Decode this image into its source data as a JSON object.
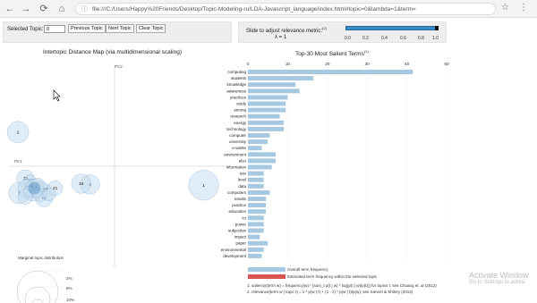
{
  "browser": {
    "url": "file:///C:/Users/Happy%20Friends/Desktop/Topic-Modeling-ru/LDA-Javascript_language/index.html#topic=0&lambda=1&term=",
    "back_icon": "←",
    "forward_icon": "→",
    "refresh_icon": "⟳",
    "home_icon": "⌂",
    "info_icon": "ⓘ",
    "star_icon": "☆",
    "menu_icon": "⋮"
  },
  "controls": {
    "selected_topic_label": "Selected Topic:",
    "topic_value": "0",
    "prev_label": "Previous Topic",
    "next_label": "Next Topic",
    "clear_label": "Clear Topic"
  },
  "relevance": {
    "title": "Slide to adjust relevance metric:",
    "footnote": "(2)",
    "lambda_text": "λ = 1",
    "ticks": [
      "0.0",
      "0.2",
      "0.4",
      "0.6",
      "0.8",
      "1.0"
    ],
    "lambda_value": 1
  },
  "map": {
    "title": "Intertopic Distance Map (via multidimensional scaling)",
    "pc1": "PC1",
    "pc2": "PC2",
    "marginal_title": "Marginal topic distribution",
    "legend": [
      "2%",
      "5%",
      "10%"
    ],
    "topics": [
      {
        "label": "1",
        "x": 1.2,
        "y": -0.25,
        "r": 1.4
      },
      {
        "label": "2",
        "x": -1.3,
        "y": 0.45,
        "r": 1.0
      },
      {
        "label": "3",
        "x": -1.28,
        "y": -0.35,
        "r": 1.0
      },
      {
        "label": "6",
        "x": -0.33,
        "y": -0.24,
        "r": 0.9
      },
      {
        "label": "12",
        "x": -0.95,
        "y": -0.42,
        "r": 0.8
      },
      {
        "label": "19",
        "x": -1.2,
        "y": -0.16,
        "r": 0.8
      },
      {
        "label": "21",
        "x": -0.8,
        "y": -0.29,
        "r": 0.7
      },
      {
        "label": "23",
        "x": -1.14,
        "y": -0.2,
        "r": 0.6
      },
      {
        "label": "34",
        "x": -0.45,
        "y": -0.23,
        "r": 0.9
      },
      {
        "label": "37",
        "x": -1.01,
        "y": -0.32,
        "r": 0.5
      },
      {
        "label": "40",
        "x": -0.93,
        "y": -0.3,
        "r": 0.5
      },
      {
        "label": "18",
        "x": -1.12,
        "y": -0.25,
        "r": 0.6
      },
      {
        "label": "",
        "x": -1.17,
        "y": -0.3,
        "r": 0.9
      },
      {
        "label": "",
        "x": -1.07,
        "y": -0.28,
        "r": 0.8
      },
      {
        "label": "",
        "x": -1.1,
        "y": -0.36,
        "r": 0.7
      },
      {
        "label": "",
        "x": -1.03,
        "y": -0.24,
        "r": 0.6
      },
      {
        "label": "",
        "x": -1.2,
        "y": -0.4,
        "r": 0.7
      },
      {
        "label": "",
        "x": -1.0,
        "y": -0.38,
        "r": 0.6
      },
      {
        "label": "",
        "x": -0.88,
        "y": -0.37,
        "r": 0.6
      },
      {
        "label": "",
        "x": -1.15,
        "y": -0.33,
        "r": 0.5
      },
      {
        "label": "",
        "x": -0.98,
        "y": -0.27,
        "r": 0.5
      },
      {
        "label": "",
        "x": -1.05,
        "y": -0.35,
        "r": 0.5
      }
    ]
  },
  "terms_chart": {
    "title": "Top-30 Most Salient Terms",
    "footnote": "(1)",
    "ticks": [
      "0",
      "10",
      "20",
      "30",
      "40",
      "50"
    ],
    "legend_overall": "Overall term frequency",
    "legend_estimated": "Estimated term frequency within the selected topic",
    "note1": "1. saliency(term w) = frequency(w) * [sum_t p(t | w) * log(p(t | w)/p(t))] for topics t; see Chuang et. al (2012)",
    "note2": "2. relevance(term w | topic t) = λ * p(w | t) + (1 - λ) * p(w | t)/p(w); see Sievert & Shirley (2014)"
  },
  "chart_data": {
    "type": "bar",
    "title": "Top-30 Most Salient Terms",
    "xlim": [
      0,
      50
    ],
    "categories": [
      "computing",
      "students",
      "knowledge",
      "awareness",
      "practices",
      "study",
      "among",
      "research",
      "energy",
      "technology",
      "computer",
      "university",
      "e-waste",
      "environment",
      "also",
      "information",
      "use",
      "level",
      "data",
      "computers",
      "results",
      "practice",
      "education",
      "ict",
      "power",
      "subjective",
      "impact",
      "paper",
      "environmental",
      "development"
    ],
    "values": [
      41.5,
      16.5,
      12,
      13,
      10,
      9.5,
      9.5,
      8,
      9,
      9,
      5.5,
      5,
      3.5,
      7,
      7,
      6,
      4,
      4,
      4,
      5.5,
      4.5,
      4.5,
      4.5,
      4,
      4,
      4,
      3,
      5,
      4,
      3.5
    ]
  },
  "watermark": {
    "line1": "Activate Window",
    "line2": "Go to Settings to activa"
  },
  "colors": {
    "bar": "#a6c8e0",
    "accent": "#d9534f",
    "topic": "#2774b5",
    "topic_fill": "#c7ddef"
  }
}
